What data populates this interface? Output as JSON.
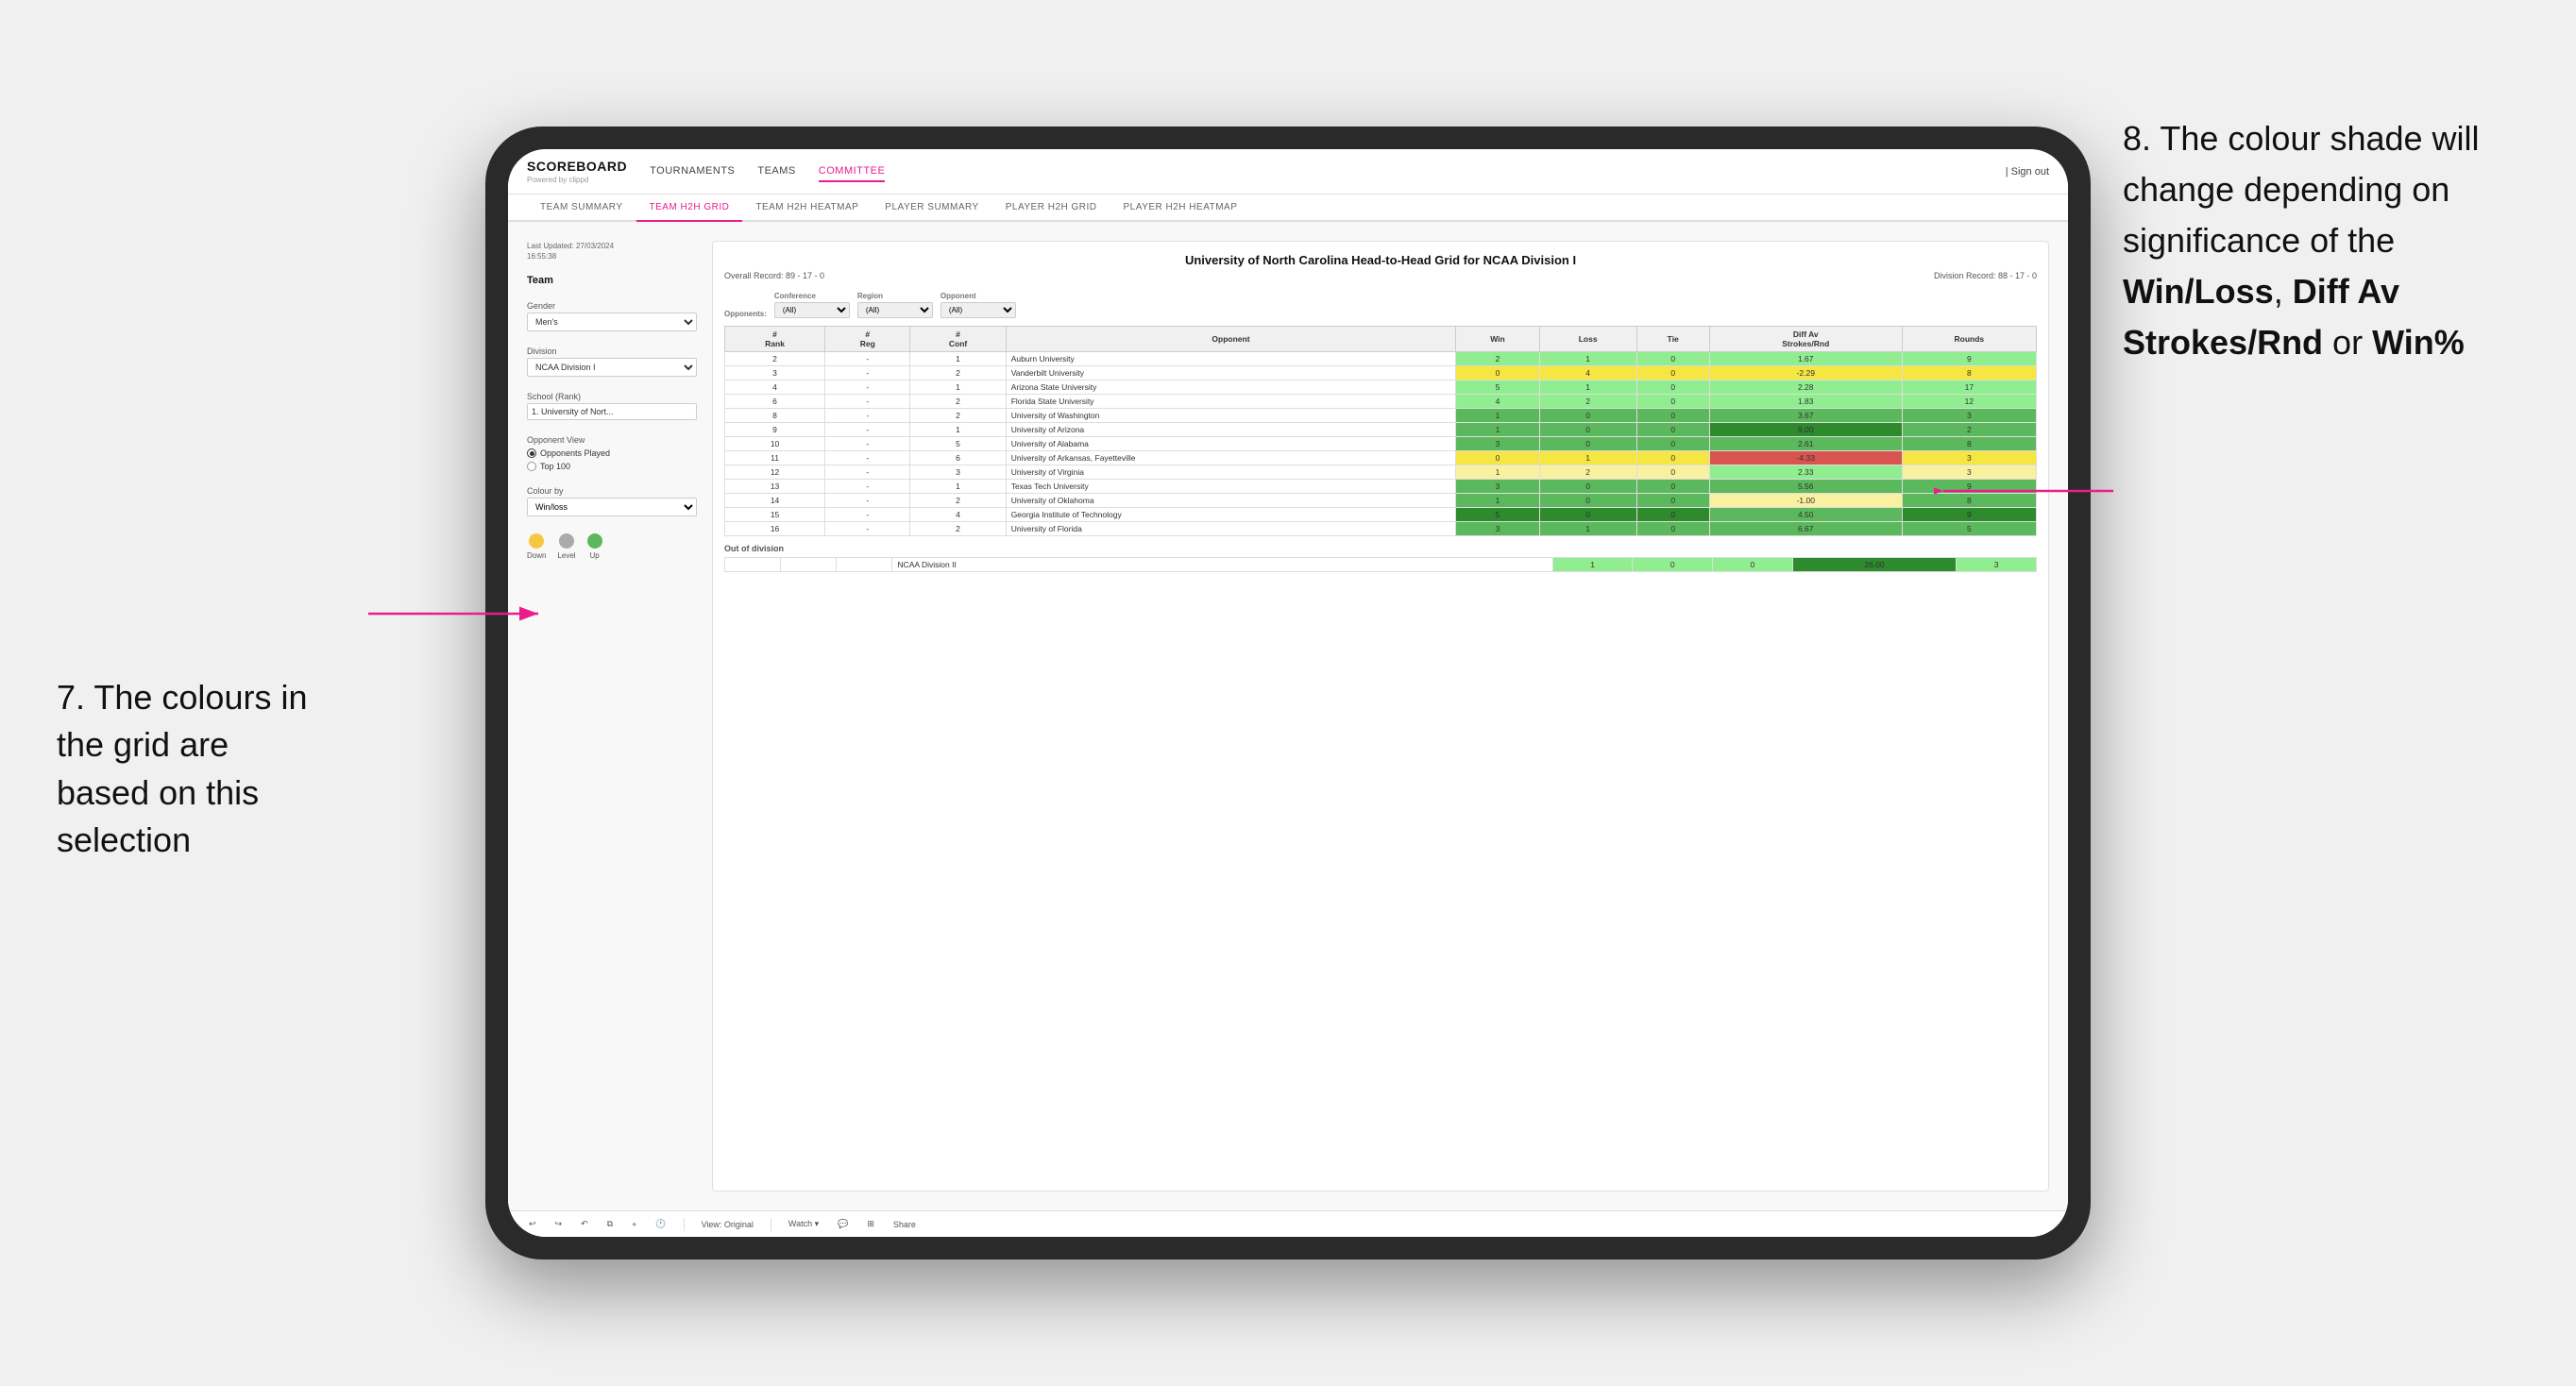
{
  "annotations": {
    "left_title": "7. The colours in the grid are based on this selection",
    "right_title": "8. The colour shade will change depending on significance of the",
    "right_bold1": "Win/Loss",
    "right_comma": ", ",
    "right_bold2": "Diff Av Strokes/Rnd",
    "right_or": " or ",
    "right_bold3": "Win%"
  },
  "nav": {
    "logo": "SCOREBOARD",
    "logo_sub": "Powered by clippd",
    "links": [
      "TOURNAMENTS",
      "TEAMS",
      "COMMITTEE"
    ],
    "active_link": "COMMITTEE",
    "sign_out": "| Sign out"
  },
  "sub_nav": {
    "tabs": [
      "TEAM SUMMARY",
      "TEAM H2H GRID",
      "TEAM H2H HEATMAP",
      "PLAYER SUMMARY",
      "PLAYER H2H GRID",
      "PLAYER H2H HEATMAP"
    ],
    "active_tab": "TEAM H2H GRID"
  },
  "sidebar": {
    "timestamp_label": "Last Updated: 27/03/2024",
    "timestamp_time": "16:55:38",
    "team_label": "Team",
    "gender_label": "Gender",
    "gender_value": "Men's",
    "division_label": "Division",
    "division_value": "NCAA Division I",
    "school_label": "School (Rank)",
    "school_value": "1. University of Nort...",
    "opponent_view_label": "Opponent View",
    "radio1": "Opponents Played",
    "radio2": "Top 100",
    "colour_by_label": "Colour by",
    "colour_by_value": "Win/loss",
    "legend": {
      "down_label": "Down",
      "level_label": "Level",
      "up_label": "Up",
      "down_color": "#f5c842",
      "level_color": "#aaaaaa",
      "up_color": "#5cb85c"
    }
  },
  "grid": {
    "title": "University of North Carolina Head-to-Head Grid for NCAA Division I",
    "overall_record": "Overall Record: 89 - 17 - 0",
    "division_record": "Division Record: 88 - 17 - 0",
    "filters": {
      "opponents_label": "Opponents:",
      "opponents_value": "(All)",
      "conference_label": "Conference",
      "conference_value": "(All)",
      "region_label": "Region",
      "region_value": "(All)",
      "opponent_label": "Opponent",
      "opponent_value": "(All)"
    },
    "columns": [
      "#\nRank",
      "#\nReg",
      "#\nConf",
      "Opponent",
      "Win",
      "Loss",
      "Tie",
      "Diff Av\nStrokes/Rnd",
      "Rounds"
    ],
    "rows": [
      {
        "rank": "2",
        "reg": "-",
        "conf": "1",
        "team": "Auburn University",
        "win": "2",
        "loss": "1",
        "tie": "0",
        "diff": "1.67",
        "rounds": "9",
        "win_color": "cell-light-green",
        "diff_color": "cell-light-green"
      },
      {
        "rank": "3",
        "reg": "-",
        "conf": "2",
        "team": "Vanderbilt University",
        "win": "0",
        "loss": "4",
        "tie": "0",
        "diff": "-2.29",
        "rounds": "8",
        "win_color": "cell-yellow",
        "diff_color": "cell-yellow"
      },
      {
        "rank": "4",
        "reg": "-",
        "conf": "1",
        "team": "Arizona State University",
        "win": "5",
        "loss": "1",
        "tie": "0",
        "diff": "2.28",
        "rounds": "17",
        "win_color": "cell-light-green",
        "diff_color": "cell-light-green"
      },
      {
        "rank": "6",
        "reg": "-",
        "conf": "2",
        "team": "Florida State University",
        "win": "4",
        "loss": "2",
        "tie": "0",
        "diff": "1.83",
        "rounds": "12",
        "win_color": "cell-light-green",
        "diff_color": "cell-light-green"
      },
      {
        "rank": "8",
        "reg": "-",
        "conf": "2",
        "team": "University of Washington",
        "win": "1",
        "loss": "0",
        "tie": "0",
        "diff": "3.67",
        "rounds": "3",
        "win_color": "cell-green",
        "diff_color": "cell-green"
      },
      {
        "rank": "9",
        "reg": "-",
        "conf": "1",
        "team": "University of Arizona",
        "win": "1",
        "loss": "0",
        "tie": "0",
        "diff": "9.00",
        "rounds": "2",
        "win_color": "cell-green",
        "diff_color": "cell-dark-green"
      },
      {
        "rank": "10",
        "reg": "-",
        "conf": "5",
        "team": "University of Alabama",
        "win": "3",
        "loss": "0",
        "tie": "0",
        "diff": "2.61",
        "rounds": "8",
        "win_color": "cell-green",
        "diff_color": "cell-green"
      },
      {
        "rank": "11",
        "reg": "-",
        "conf": "6",
        "team": "University of Arkansas, Fayetteville",
        "win": "0",
        "loss": "1",
        "tie": "0",
        "diff": "-4.33",
        "rounds": "3",
        "win_color": "cell-yellow",
        "diff_color": "cell-red"
      },
      {
        "rank": "12",
        "reg": "-",
        "conf": "3",
        "team": "University of Virginia",
        "win": "1",
        "loss": "2",
        "tie": "0",
        "diff": "2.33",
        "rounds": "3",
        "win_color": "cell-light-yellow",
        "diff_color": "cell-light-green"
      },
      {
        "rank": "13",
        "reg": "-",
        "conf": "1",
        "team": "Texas Tech University",
        "win": "3",
        "loss": "0",
        "tie": "0",
        "diff": "5.56",
        "rounds": "9",
        "win_color": "cell-green",
        "diff_color": "cell-green"
      },
      {
        "rank": "14",
        "reg": "-",
        "conf": "2",
        "team": "University of Oklahoma",
        "win": "1",
        "loss": "0",
        "tie": "0",
        "diff": "-1.00",
        "rounds": "8",
        "win_color": "cell-green",
        "diff_color": "cell-light-yellow"
      },
      {
        "rank": "15",
        "reg": "-",
        "conf": "4",
        "team": "Georgia Institute of Technology",
        "win": "5",
        "loss": "0",
        "tie": "0",
        "diff": "4.50",
        "rounds": "9",
        "win_color": "cell-dark-green",
        "diff_color": "cell-green"
      },
      {
        "rank": "16",
        "reg": "-",
        "conf": "2",
        "team": "University of Florida",
        "win": "3",
        "loss": "1",
        "tie": "0",
        "diff": "6.67",
        "rounds": "5",
        "win_color": "cell-green",
        "diff_color": "cell-green"
      }
    ],
    "out_of_division_label": "Out of division",
    "out_of_division_row": {
      "division": "NCAA Division II",
      "win": "1",
      "loss": "0",
      "tie": "0",
      "diff": "26.00",
      "rounds": "3",
      "diff_color": "cell-dark-green"
    }
  },
  "toolbar": {
    "view_label": "View: Original",
    "watch_label": "Watch ▾",
    "share_label": "Share"
  }
}
